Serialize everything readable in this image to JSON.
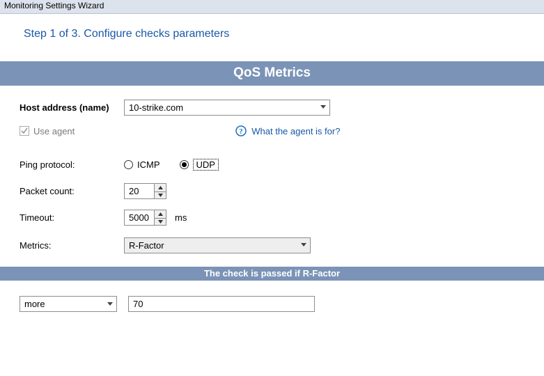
{
  "window": {
    "title": "Monitoring Settings Wizard"
  },
  "step": {
    "title": "Step 1 of 3. Configure checks parameters"
  },
  "banner": {
    "title": "QoS Metrics"
  },
  "host": {
    "label": "Host address (name)",
    "value": "10-strike.com"
  },
  "agent": {
    "label": "Use agent",
    "checked": true,
    "whatFor": "What the agent is for?"
  },
  "pingProtocol": {
    "label": "Ping protocol:",
    "options": {
      "icmp": "ICMP",
      "udp": "UDP"
    },
    "selected": "udp"
  },
  "packetCount": {
    "label": "Packet count:",
    "value": "20"
  },
  "timeout": {
    "label": "Timeout:",
    "value": "5000",
    "unit": "ms"
  },
  "metrics": {
    "label": "Metrics:",
    "value": "R-Factor"
  },
  "conditionBanner": {
    "title": "The check is passed if R-Factor"
  },
  "condition": {
    "operator": "more",
    "threshold": "70"
  }
}
